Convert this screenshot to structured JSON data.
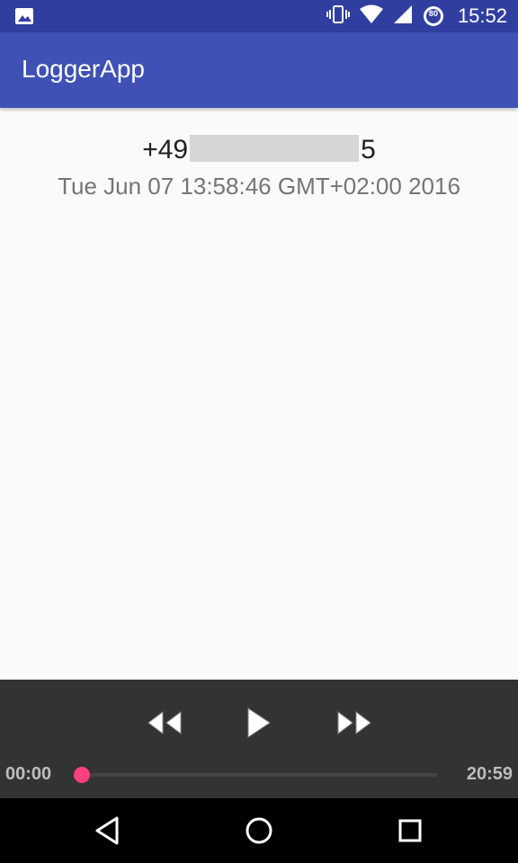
{
  "status_bar": {
    "time": "15:52",
    "battery_level": "80",
    "icons": [
      "image-icon",
      "vibrate-icon",
      "wifi-icon",
      "signal-icon",
      "battery-icon"
    ]
  },
  "app_bar": {
    "title": "LoggerApp"
  },
  "entry": {
    "phone_prefix": "+49",
    "phone_suffix": "5",
    "timestamp": "Tue Jun 07 13:58:46 GMT+02:00 2016"
  },
  "player": {
    "elapsed": "00:00",
    "duration": "20:59",
    "progress_fraction": 0,
    "accent_color": "#ff4081"
  },
  "nav_bar": {
    "icons": [
      "back-icon",
      "home-icon",
      "recents-icon"
    ]
  }
}
